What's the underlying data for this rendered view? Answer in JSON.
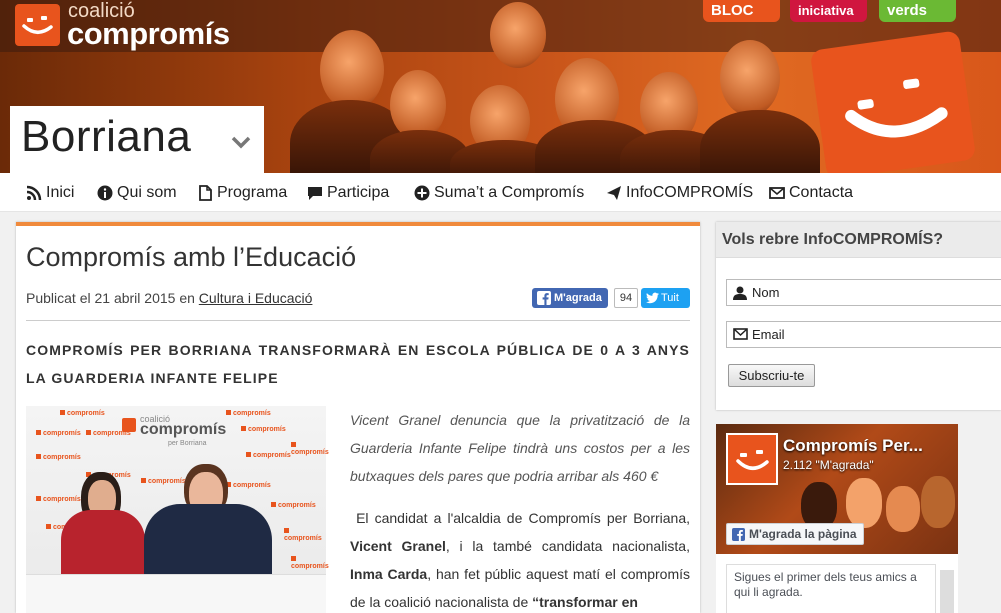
{
  "header": {
    "logo_line1": "coalició",
    "logo_line2": "compromís",
    "partners": [
      {
        "label": "BLOC",
        "color": "#e8541d"
      },
      {
        "label": "iniciativa",
        "color": "#d0163f"
      },
      {
        "label": "verds",
        "color": "#6bb934"
      }
    ],
    "town": "Borriana",
    "accent_color": "#e8541d"
  },
  "nav": {
    "items": [
      {
        "label": "Inici",
        "icon": "rss-icon"
      },
      {
        "label": "Qui som",
        "icon": "info-icon"
      },
      {
        "label": "Programa",
        "icon": "document-icon"
      },
      {
        "label": "Participa",
        "icon": "comment-icon"
      },
      {
        "label": "Suma’t a Compromís",
        "icon": "plus-circle-icon"
      },
      {
        "label": "InfoCOMPROMÍS",
        "icon": "send-icon"
      },
      {
        "label": "Contacta",
        "icon": "envelope-icon"
      }
    ]
  },
  "article": {
    "title": "Compromís amb l’Educació",
    "meta_prefix": "Publicat el 21 abril 2015 en",
    "category": "Cultura i Educació",
    "fb_like_label": "M'agrada",
    "fb_count": "94",
    "tweet_label": "Tuit",
    "lead": "COMPROMÍS PER BORRIANA TRANSFORMARÀ EN ESCOLA PÚBLICA DE 0 A 3 ANYS LA GUARDERIA INFANTE FELIPE",
    "photo_brand_line1": "coalició",
    "photo_brand_line2": "compromís",
    "photo_brand_line3": "per Borriana",
    "photo_tag": "compromís",
    "intro": "Vicent Granel denuncia que la privatització de la Guarderia Infante Felipe tindrà uns costos per a les butxaques dels pares que podria arribar als 460 €",
    "body_part1": "El candidat a l'alcaldia de Compromís per Borriana,",
    "body_name1": "Vicent Granel",
    "body_part2": ", i la també candidata nacionalista,",
    "body_name2": "Inma Carda",
    "body_part3": ", han fet públic aquest matí el compromís de la coalició nacionalista de",
    "body_quote": "“transformar en"
  },
  "sidebar": {
    "subscribe_title": "Vols rebre InfoCOMPROMÍS?",
    "name_placeholder": "Nom",
    "email_placeholder": "Email",
    "subscribe_button": "Subscriu-te",
    "fb_page_name": "Compromís Per...",
    "fb_page_likes": "2.112 \"M'agrada\"",
    "fb_like_page": "M'agrada la pàgina",
    "fb_friends_text": "Sigues el primer dels teus amics a qui li agrada."
  }
}
